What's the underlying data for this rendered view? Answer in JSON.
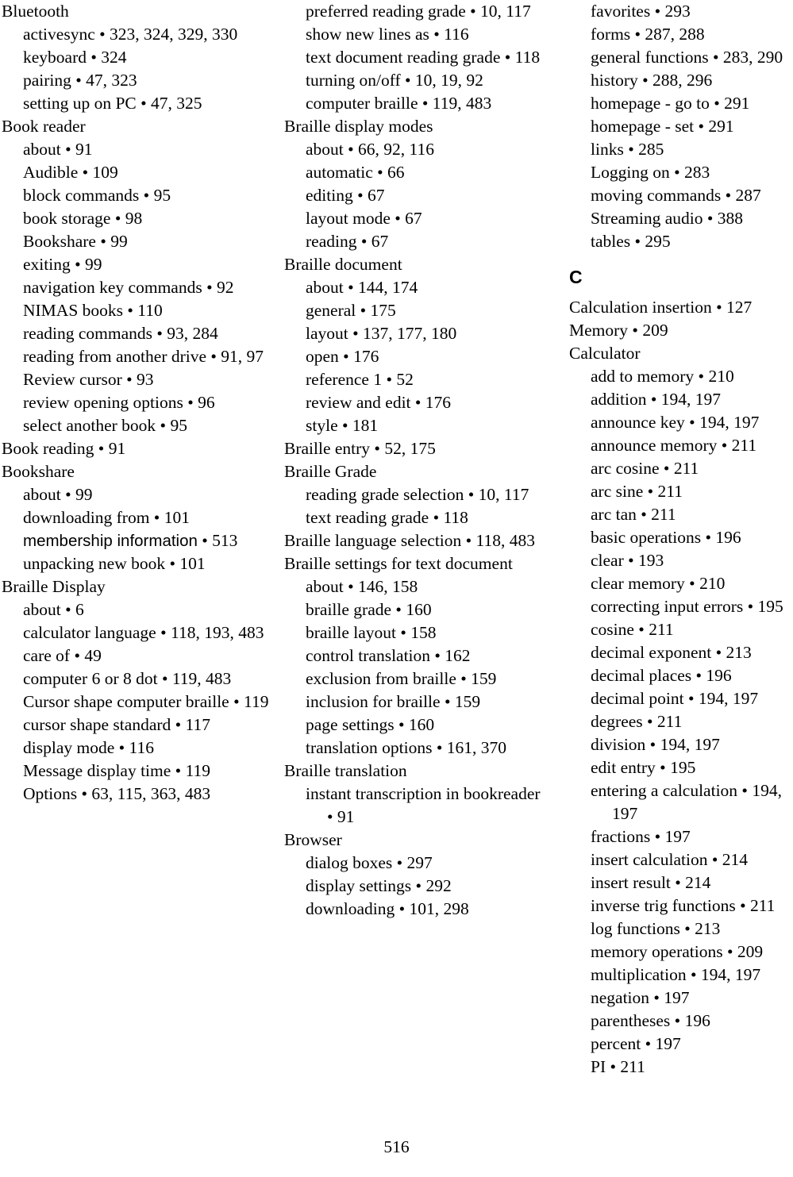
{
  "document": {
    "type": "book-index",
    "page_number": "516"
  },
  "columns": [
    {
      "id": "column-1",
      "entries": [
        {
          "level": 0,
          "text": "Bluetooth"
        },
        {
          "level": 1,
          "text": "activesync • 323, 324, 329, 330"
        },
        {
          "level": 1,
          "text": "keyboard • 324"
        },
        {
          "level": 1,
          "text": "pairing • 47, 323"
        },
        {
          "level": 1,
          "text": "setting up on PC • 47, 325"
        },
        {
          "level": 0,
          "text": "Book reader"
        },
        {
          "level": 1,
          "text": "about • 91"
        },
        {
          "level": 1,
          "text": "Audible • 109"
        },
        {
          "level": 1,
          "text": "block commands • 95"
        },
        {
          "level": 1,
          "text": "book storage • 98"
        },
        {
          "level": 1,
          "text": "Bookshare • 99"
        },
        {
          "level": 1,
          "text": "exiting • 99"
        },
        {
          "level": 1,
          "text": "navigation key commands • 92"
        },
        {
          "level": 1,
          "text": "NIMAS books • 110"
        },
        {
          "level": 1,
          "text": "reading commands • 93, 284"
        },
        {
          "level": 1,
          "text": "reading from another drive • 91, 97"
        },
        {
          "level": 1,
          "text": "Review cursor • 93"
        },
        {
          "level": 1,
          "text": "review opening options • 96"
        },
        {
          "level": 1,
          "text": "select another book • 95"
        },
        {
          "level": 0,
          "text": "Book reading • 91"
        },
        {
          "level": 0,
          "text": "Bookshare"
        },
        {
          "level": 1,
          "text": "about • 99"
        },
        {
          "level": 1,
          "text": "downloading from • 101"
        },
        {
          "level": 1,
          "sans_term": "membership information",
          "text": " • 513"
        },
        {
          "level": 1,
          "text": "unpacking new book • 101"
        },
        {
          "level": 0,
          "text": "Braille Display"
        },
        {
          "level": 1,
          "text": "about • 6"
        },
        {
          "level": 1,
          "text": "calculator language • 118, 193, 483"
        },
        {
          "level": 1,
          "text": "care of • 49"
        },
        {
          "level": 1,
          "text": "computer 6 or 8 dot • 119, 483"
        },
        {
          "level": 1,
          "text": "Cursor shape computer braille • 119"
        },
        {
          "level": 1,
          "text": "cursor shape standard • 117"
        },
        {
          "level": 1,
          "text": "display mode • 116"
        },
        {
          "level": 1,
          "text": "Message display time • 119"
        },
        {
          "level": 1,
          "text": "Options • 63, 115, 363, 483"
        }
      ]
    },
    {
      "id": "column-2",
      "entries": [
        {
          "level": 1,
          "text": "preferred reading grade • 10, 117"
        },
        {
          "level": 1,
          "text": "show new lines as • 116"
        },
        {
          "level": 1,
          "text": "text document reading grade • 118"
        },
        {
          "level": 1,
          "text": "turning on/off • 10, 19, 92"
        },
        {
          "level": 1,
          "text": "computer braille • 119, 483"
        },
        {
          "level": 0,
          "text": "Braille display modes"
        },
        {
          "level": 1,
          "text": "about • 66, 92, 116"
        },
        {
          "level": 1,
          "text": "automatic • 66"
        },
        {
          "level": 1,
          "text": "editing • 67"
        },
        {
          "level": 1,
          "text": "layout mode • 67"
        },
        {
          "level": 1,
          "text": "reading • 67"
        },
        {
          "level": 0,
          "text": "Braille document"
        },
        {
          "level": 1,
          "text": "about • 144, 174"
        },
        {
          "level": 1,
          "text": "general • 175"
        },
        {
          "level": 1,
          "text": "layout • 137, 177, 180"
        },
        {
          "level": 1,
          "text": "open • 176"
        },
        {
          "level": 1,
          "text": "reference 1 • 52"
        },
        {
          "level": 1,
          "text": "review and edit • 176"
        },
        {
          "level": 1,
          "text": "style • 181"
        },
        {
          "level": 0,
          "text": "Braille entry • 52, 175"
        },
        {
          "level": 0,
          "text": "Braille Grade"
        },
        {
          "level": 1,
          "text": "reading grade selection • 10, 117"
        },
        {
          "level": 1,
          "text": "text reading grade • 118"
        },
        {
          "level": 0,
          "text": "Braille language selection • 118, 483"
        },
        {
          "level": 0,
          "text": "Braille settings for text document"
        },
        {
          "level": 1,
          "text": "about • 146, 158"
        },
        {
          "level": 1,
          "text": "braille grade • 160"
        },
        {
          "level": 1,
          "text": "braille layout • 158"
        },
        {
          "level": 1,
          "text": "control translation • 162"
        },
        {
          "level": 1,
          "text": "exclusion from braille • 159"
        },
        {
          "level": 1,
          "text": "inclusion for braille • 159"
        },
        {
          "level": 1,
          "text": "page settings • 160"
        },
        {
          "level": 1,
          "text": "translation options • 161, 370"
        },
        {
          "level": 0,
          "text": "Braille translation"
        },
        {
          "level": 1,
          "text": "instant transcription in bookreader • 91"
        },
        {
          "level": 0,
          "text": "Browser"
        },
        {
          "level": 1,
          "text": "dialog boxes • 297"
        },
        {
          "level": 1,
          "text": "display settings • 292"
        },
        {
          "level": 1,
          "text": "downloading • 101, 298"
        }
      ]
    },
    {
      "id": "column-3",
      "entries": [
        {
          "level": 1,
          "text": "favorites • 293"
        },
        {
          "level": 1,
          "text": "forms • 287, 288"
        },
        {
          "level": 1,
          "text": "general functions • 283, 290"
        },
        {
          "level": 1,
          "text": "history • 288, 296"
        },
        {
          "level": 1,
          "text": "homepage - go to • 291"
        },
        {
          "level": 1,
          "text": "homepage - set • 291"
        },
        {
          "level": 1,
          "text": "links • 285"
        },
        {
          "level": 1,
          "text": "Logging on • 283"
        },
        {
          "level": 1,
          "text": "moving commands • 287"
        },
        {
          "level": 1,
          "text": "Streaming audio • 388"
        },
        {
          "level": 1,
          "text": "tables • 295"
        },
        {
          "level": "letter",
          "text": "C"
        },
        {
          "level": 0,
          "text": "Calculation insertion • 127"
        },
        {
          "level": 0,
          "text": "Memory • 209"
        },
        {
          "level": 0,
          "text": "Calculator"
        },
        {
          "level": 1,
          "text": "add to memory • 210"
        },
        {
          "level": 1,
          "text": "addition • 194, 197"
        },
        {
          "level": 1,
          "text": "announce key • 194, 197"
        },
        {
          "level": 1,
          "text": "announce memory • 211"
        },
        {
          "level": 1,
          "text": "arc cosine • 211"
        },
        {
          "level": 1,
          "text": "arc sine • 211"
        },
        {
          "level": 1,
          "text": "arc tan • 211"
        },
        {
          "level": 1,
          "text": "basic operations • 196"
        },
        {
          "level": 1,
          "text": "clear • 193"
        },
        {
          "level": 1,
          "text": "clear memory • 210"
        },
        {
          "level": 1,
          "text": "correcting input errors • 195"
        },
        {
          "level": 1,
          "text": "cosine • 211"
        },
        {
          "level": 1,
          "text": "decimal exponent • 213"
        },
        {
          "level": 1,
          "text": "decimal places • 196"
        },
        {
          "level": 1,
          "text": "decimal point • 194, 197"
        },
        {
          "level": 1,
          "text": "degrees • 211"
        },
        {
          "level": 1,
          "text": "division • 194, 197"
        },
        {
          "level": 1,
          "text": "edit entry • 195"
        },
        {
          "level": 1,
          "text": "entering a calculation • 194, 197"
        },
        {
          "level": 1,
          "text": "fractions • 197"
        },
        {
          "level": 1,
          "text": "insert calculation • 214"
        },
        {
          "level": 1,
          "text": "insert result • 214"
        },
        {
          "level": 1,
          "text": "inverse trig functions • 211"
        },
        {
          "level": 1,
          "text": "log functions • 213"
        },
        {
          "level": 1,
          "text": "memory operations • 209"
        },
        {
          "level": 1,
          "text": "multiplication • 194, 197"
        },
        {
          "level": 1,
          "text": "negation • 197"
        },
        {
          "level": 1,
          "text": "parentheses • 196"
        },
        {
          "level": 1,
          "text": "percent • 197"
        },
        {
          "level": 1,
          "text": "PI • 211"
        }
      ]
    }
  ]
}
